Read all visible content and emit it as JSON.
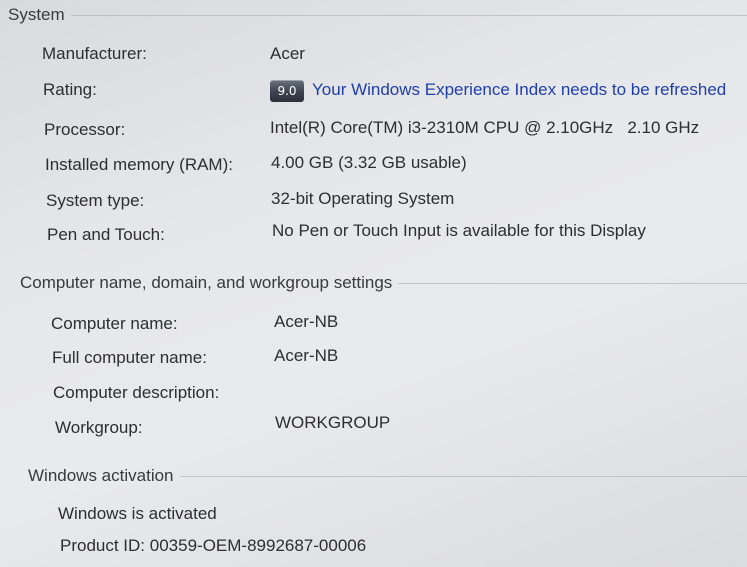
{
  "system": {
    "header": "System",
    "rows": [
      {
        "label": "Manufacturer:",
        "value": "Acer"
      },
      {
        "label": "Rating:",
        "badge": "9.0",
        "value": "Your Windows Experience Index needs to be refreshed"
      },
      {
        "label": "Processor:",
        "value": "Intel(R) Core(TM) i3-2310M CPU @ 2.10GHz   2.10 GHz"
      },
      {
        "label": "Installed memory (RAM):",
        "value": "4.00 GB (3.32 GB usable)"
      },
      {
        "label": "System type:",
        "value": "32-bit Operating System"
      },
      {
        "label": "Pen and Touch:",
        "value": "No Pen or Touch Input is available for this Display"
      }
    ]
  },
  "computer_name": {
    "header": "Computer name, domain, and workgroup settings",
    "rows": [
      {
        "label": "Computer name:",
        "value": "Acer-NB"
      },
      {
        "label": "Full computer name:",
        "value": "Acer-NB"
      },
      {
        "label": "Computer description:",
        "value": ""
      },
      {
        "label": "Workgroup:",
        "value": "WORKGROUP"
      }
    ]
  },
  "activation": {
    "header": "Windows activation",
    "status": "Windows is activated",
    "product_id": "Product ID: 00359-OEM-8992687-00006"
  },
  "colors": {
    "link": "#1f3fa8",
    "text": "#2e2e2e",
    "background": "#e6e7ea"
  }
}
